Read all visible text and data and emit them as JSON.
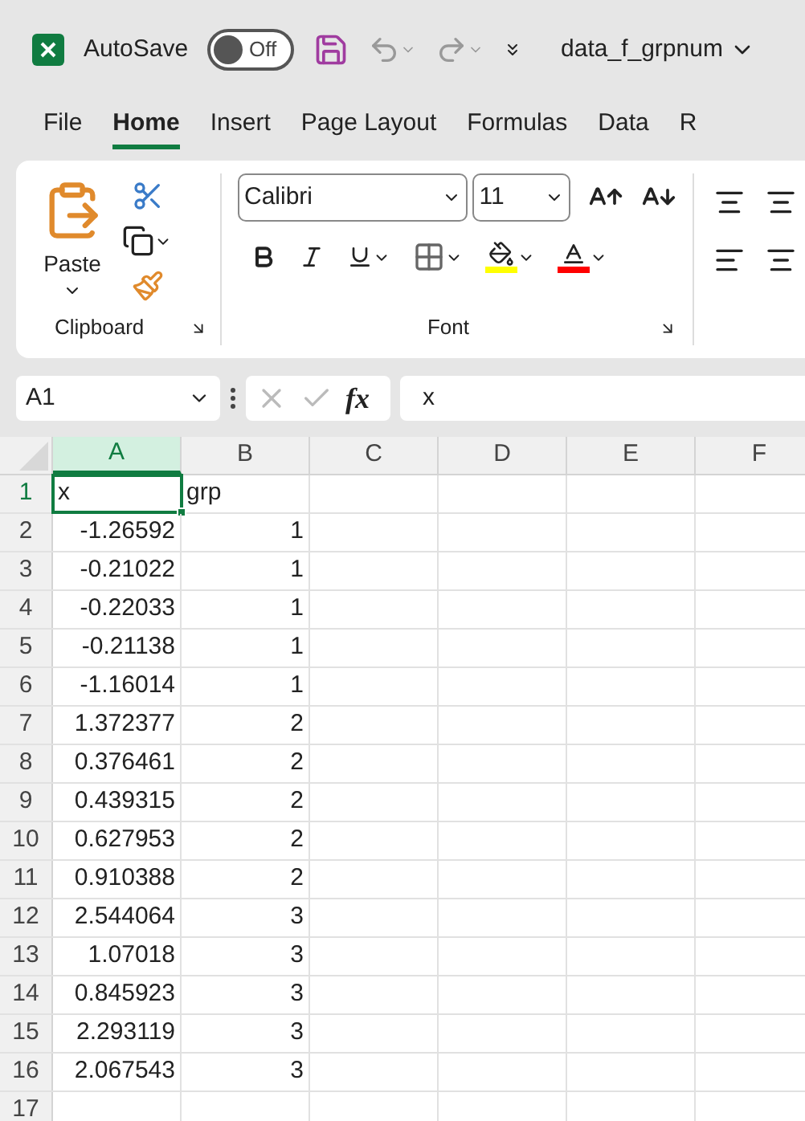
{
  "title_bar": {
    "autosave_label": "AutoSave",
    "autosave_toggle": {
      "label": "Off",
      "on": false
    },
    "file_name": "data_f_grpnum"
  },
  "ribbon_tabs": [
    {
      "label": "File",
      "selected": false
    },
    {
      "label": "Home",
      "selected": true
    },
    {
      "label": "Insert",
      "selected": false
    },
    {
      "label": "Page Layout",
      "selected": false
    },
    {
      "label": "Formulas",
      "selected": false
    },
    {
      "label": "Data",
      "selected": false
    },
    {
      "label": "R",
      "selected": false
    }
  ],
  "ribbon": {
    "paste_label": "Paste",
    "clipboard_group": "Clipboard",
    "font_group": "Font",
    "font_name": "Calibri",
    "font_size": "11"
  },
  "formula_bar": {
    "name_box": "A1",
    "fx": "fx",
    "value": "x"
  },
  "columns": [
    {
      "label": "A",
      "selected": true
    },
    {
      "label": "B",
      "selected": false
    },
    {
      "label": "C",
      "selected": false
    },
    {
      "label": "D",
      "selected": false
    },
    {
      "label": "E",
      "selected": false
    },
    {
      "label": "F",
      "selected": false
    }
  ],
  "rows": [
    {
      "number": "1",
      "cells": [
        {
          "kind": "text",
          "value": "x",
          "selected": true
        },
        {
          "kind": "text",
          "value": "grp",
          "selected": false
        }
      ]
    },
    {
      "number": "2",
      "cells": [
        {
          "kind": "number",
          "value": "-1.26592",
          "selected": false
        },
        {
          "kind": "number",
          "value": "1",
          "selected": false
        }
      ]
    },
    {
      "number": "3",
      "cells": [
        {
          "kind": "number",
          "value": "-0.21022",
          "selected": false
        },
        {
          "kind": "number",
          "value": "1",
          "selected": false
        }
      ]
    },
    {
      "number": "4",
      "cells": [
        {
          "kind": "number",
          "value": "-0.22033",
          "selected": false
        },
        {
          "kind": "number",
          "value": "1",
          "selected": false
        }
      ]
    },
    {
      "number": "5",
      "cells": [
        {
          "kind": "number",
          "value": "-0.21138",
          "selected": false
        },
        {
          "kind": "number",
          "value": "1",
          "selected": false
        }
      ]
    },
    {
      "number": "6",
      "cells": [
        {
          "kind": "number",
          "value": "-1.16014",
          "selected": false
        },
        {
          "kind": "number",
          "value": "1",
          "selected": false
        }
      ]
    },
    {
      "number": "7",
      "cells": [
        {
          "kind": "number",
          "value": "1.372377",
          "selected": false
        },
        {
          "kind": "number",
          "value": "2",
          "selected": false
        }
      ]
    },
    {
      "number": "8",
      "cells": [
        {
          "kind": "number",
          "value": "0.376461",
          "selected": false
        },
        {
          "kind": "number",
          "value": "2",
          "selected": false
        }
      ]
    },
    {
      "number": "9",
      "cells": [
        {
          "kind": "number",
          "value": "0.439315",
          "selected": false
        },
        {
          "kind": "number",
          "value": "2",
          "selected": false
        }
      ]
    },
    {
      "number": "10",
      "cells": [
        {
          "kind": "number",
          "value": "0.627953",
          "selected": false
        },
        {
          "kind": "number",
          "value": "2",
          "selected": false
        }
      ]
    },
    {
      "number": "11",
      "cells": [
        {
          "kind": "number",
          "value": "0.910388",
          "selected": false
        },
        {
          "kind": "number",
          "value": "2",
          "selected": false
        }
      ]
    },
    {
      "number": "12",
      "cells": [
        {
          "kind": "number",
          "value": "2.544064",
          "selected": false
        },
        {
          "kind": "number",
          "value": "3",
          "selected": false
        }
      ]
    },
    {
      "number": "13",
      "cells": [
        {
          "kind": "number",
          "value": "1.07018",
          "selected": false
        },
        {
          "kind": "number",
          "value": "3",
          "selected": false
        }
      ]
    },
    {
      "number": "14",
      "cells": [
        {
          "kind": "number",
          "value": "0.845923",
          "selected": false
        },
        {
          "kind": "number",
          "value": "3",
          "selected": false
        }
      ]
    },
    {
      "number": "15",
      "cells": [
        {
          "kind": "number",
          "value": "2.293119",
          "selected": false
        },
        {
          "kind": "number",
          "value": "3",
          "selected": false
        }
      ]
    },
    {
      "number": "16",
      "cells": [
        {
          "kind": "number",
          "value": "2.067543",
          "selected": false
        },
        {
          "kind": "number",
          "value": "3",
          "selected": false
        }
      ]
    },
    {
      "number": "17",
      "cells": []
    }
  ]
}
